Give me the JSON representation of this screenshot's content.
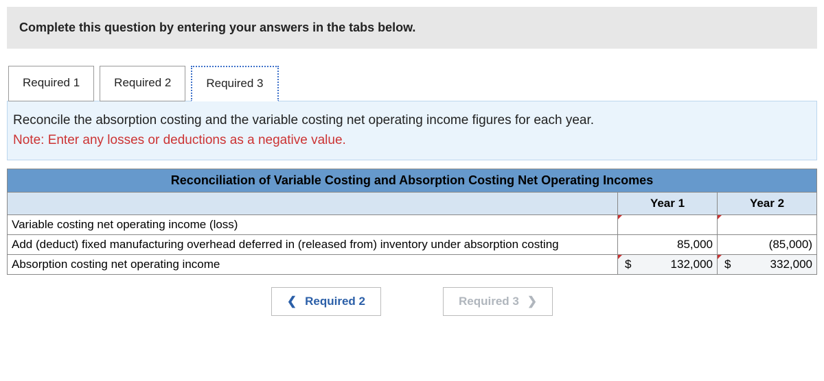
{
  "instruction": "Complete this question by entering your answers in the tabs below.",
  "tabs": [
    {
      "label": "Required 1"
    },
    {
      "label": "Required 2"
    },
    {
      "label": "Required 3"
    }
  ],
  "panel": {
    "line1": "Reconcile the absorption costing and the variable costing net operating income figures for each year.",
    "line2": "Note: Enter any losses or deductions as a negative value."
  },
  "table": {
    "title": "Reconciliation of Variable Costing and Absorption Costing Net Operating Incomes",
    "col1": "Year 1",
    "col2": "Year 2",
    "rows": [
      {
        "label": "Variable costing net operating income (loss)",
        "y1": "",
        "y2": ""
      },
      {
        "label": "Add (deduct) fixed manufacturing overhead deferred in (released from) inventory under absorption costing",
        "y1": "85,000",
        "y2": "(85,000)"
      },
      {
        "label": "Absorption costing net operating income",
        "y1_prefix": "$",
        "y1": "132,000",
        "y2_prefix": "$",
        "y2": "332,000"
      }
    ]
  },
  "nav": {
    "prev": "Required 2",
    "next": "Required 3"
  }
}
